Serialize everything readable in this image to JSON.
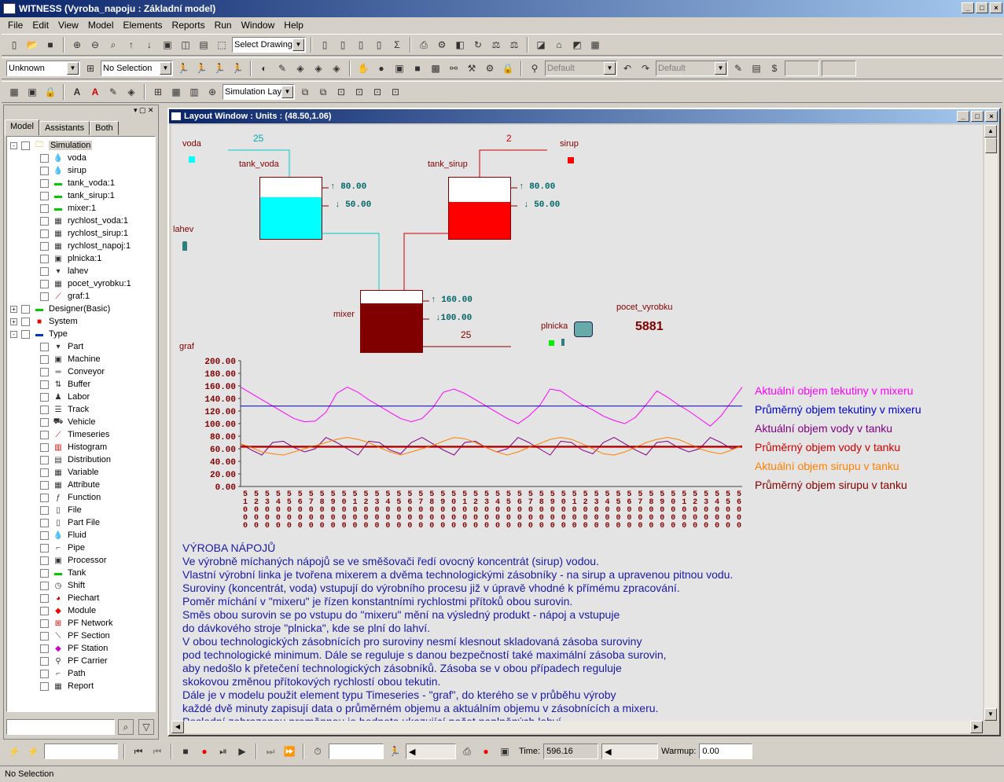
{
  "app": {
    "title": "WITNESS (Vyroba_napoju : Základní model)"
  },
  "menu": [
    "File",
    "Edit",
    "View",
    "Model",
    "Elements",
    "Reports",
    "Run",
    "Window",
    "Help"
  ],
  "toolbar": {
    "select_drawing": "Select Drawing",
    "unknown": "Unknown",
    "no_selection": "No Selection",
    "default1": "Default",
    "default2": "Default",
    "simulation_layer": "Simulation Laye"
  },
  "left_panel": {
    "tabs": [
      "Model",
      "Assistants",
      "Both"
    ],
    "tree": [
      {
        "label": "Simulation",
        "level": 0,
        "exp": "-",
        "icon": "folder-icon"
      },
      {
        "label": "voda",
        "level": 1,
        "icon": "fluid-icon"
      },
      {
        "label": "sirup",
        "level": 1,
        "icon": "fluid-icon"
      },
      {
        "label": "tank_voda:1",
        "level": 1,
        "icon": "tank-icon"
      },
      {
        "label": "tank_sirup:1",
        "level": 1,
        "icon": "tank-icon"
      },
      {
        "label": "mixer:1",
        "level": 1,
        "icon": "tank-icon"
      },
      {
        "label": "rychlost_voda:1",
        "level": 1,
        "icon": "variable-icon"
      },
      {
        "label": "rychlost_sirup:1",
        "level": 1,
        "icon": "variable-icon"
      },
      {
        "label": "rychlost_napoj:1",
        "level": 1,
        "icon": "variable-icon"
      },
      {
        "label": "plnicka:1",
        "level": 1,
        "icon": "processor-icon"
      },
      {
        "label": "lahev",
        "level": 1,
        "icon": "part-icon"
      },
      {
        "label": "pocet_vyrobku:1",
        "level": 1,
        "icon": "variable-icon"
      },
      {
        "label": "graf:1",
        "level": 1,
        "icon": "timeseries-icon"
      },
      {
        "label": "Designer(Basic)",
        "level": 0,
        "exp": "+",
        "icon": "designer-icon"
      },
      {
        "label": "System",
        "level": 0,
        "exp": "+",
        "icon": "system-icon"
      },
      {
        "label": "Type",
        "level": 0,
        "exp": "-",
        "icon": "type-icon"
      },
      {
        "label": "Part",
        "level": 1,
        "icon": "part-icon"
      },
      {
        "label": "Machine",
        "level": 1,
        "icon": "machine-icon"
      },
      {
        "label": "Conveyor",
        "level": 1,
        "icon": "conveyor-icon"
      },
      {
        "label": "Buffer",
        "level": 1,
        "icon": "buffer-icon"
      },
      {
        "label": "Labor",
        "level": 1,
        "icon": "labor-icon"
      },
      {
        "label": "Track",
        "level": 1,
        "icon": "track-icon"
      },
      {
        "label": "Vehicle",
        "level": 1,
        "icon": "vehicle-icon"
      },
      {
        "label": "Timeseries",
        "level": 1,
        "icon": "timeseries-icon"
      },
      {
        "label": "Histogram",
        "level": 1,
        "icon": "histogram-icon"
      },
      {
        "label": "Distribution",
        "level": 1,
        "icon": "distribution-icon"
      },
      {
        "label": "Variable",
        "level": 1,
        "icon": "variable-icon"
      },
      {
        "label": "Attribute",
        "level": 1,
        "icon": "attribute-icon"
      },
      {
        "label": "Function",
        "level": 1,
        "icon": "function-icon"
      },
      {
        "label": "File",
        "level": 1,
        "icon": "file-icon"
      },
      {
        "label": "Part File",
        "level": 1,
        "icon": "partfile-icon"
      },
      {
        "label": "Fluid",
        "level": 1,
        "icon": "fluid-icon"
      },
      {
        "label": "Pipe",
        "level": 1,
        "icon": "pipe-icon"
      },
      {
        "label": "Processor",
        "level": 1,
        "icon": "processor-icon"
      },
      {
        "label": "Tank",
        "level": 1,
        "icon": "tank-icon"
      },
      {
        "label": "Shift",
        "level": 1,
        "icon": "shift-icon"
      },
      {
        "label": "Piechart",
        "level": 1,
        "icon": "piechart-icon"
      },
      {
        "label": "Module",
        "level": 1,
        "icon": "module-icon"
      },
      {
        "label": "PF Network",
        "level": 1,
        "icon": "pfnetwork-icon"
      },
      {
        "label": "PF Section",
        "level": 1,
        "icon": "pfsection-icon"
      },
      {
        "label": "PF Station",
        "level": 1,
        "icon": "pfstation-icon"
      },
      {
        "label": "PF Carrier",
        "level": 1,
        "icon": "pfcarrier-icon"
      },
      {
        "label": "Path",
        "level": 1,
        "icon": "path-icon"
      },
      {
        "label": "Report",
        "level": 1,
        "icon": "report-icon"
      }
    ]
  },
  "layout_window": {
    "title": "Layout Window  : Units : (48.50,1.06)",
    "voda": "voda",
    "sirup": "sirup",
    "lahev": "lahev",
    "tank_voda": "tank_voda",
    "tank_sirup": "tank_sirup",
    "mixer": "mixer",
    "plnicka": "plnicka",
    "pocet_vyrobku": "pocet_vyrobku",
    "pocet_value": "5881",
    "voda_rate": "25",
    "sirup_rate": "2",
    "mixer_rate": "25",
    "tank_voda_hi": "80.00",
    "tank_voda_lo": "50.00",
    "tank_sirup_hi": "80.00",
    "tank_sirup_lo": "50.00",
    "mixer_hi": "160.00",
    "mixer_lo": "100.00",
    "graf": "graf",
    "tank_voda_level": 0.68,
    "tank_sirup_level": 0.6,
    "mixer_level": 0.8
  },
  "chart_data": {
    "type": "line",
    "ylim": [
      0,
      200
    ],
    "yticks": [
      "200.00",
      "180.00",
      "160.00",
      "140.00",
      "120.00",
      "100.00",
      "80.00",
      "60.00",
      "40.00",
      "20.00",
      "0.00"
    ],
    "xticks": [
      "510",
      "520",
      "530",
      "540",
      "550",
      "560",
      "570",
      "580",
      "590",
      "600",
      "610",
      "620",
      "630",
      "640",
      "650",
      "660",
      "670",
      "680",
      "690",
      "700",
      "710",
      "720",
      "730",
      "740",
      "750",
      "760",
      "770",
      "780",
      "790",
      "800",
      "810",
      "820",
      "830",
      "840",
      "850",
      "860",
      "870",
      "880",
      "890",
      "900",
      "910",
      "920",
      "930",
      "940",
      "950",
      "960"
    ],
    "xticks_top": [
      "5",
      "5",
      "5",
      "5",
      "5",
      "5",
      "5",
      "5",
      "5",
      "5",
      "5",
      "5",
      "5",
      "5",
      "5",
      "5",
      "5",
      "5",
      "5",
      "5",
      "5",
      "5",
      "5",
      "5",
      "5",
      "5",
      "5",
      "5",
      "5",
      "5",
      "5",
      "5",
      "5",
      "5",
      "5",
      "5",
      "5",
      "5",
      "5",
      "5",
      "5",
      "5",
      "5",
      "5",
      "5",
      "5"
    ],
    "xticks_mid": [
      "1",
      "2",
      "3",
      "4",
      "5",
      "6",
      "7",
      "8",
      "9",
      "0",
      "1",
      "2",
      "3",
      "4",
      "5",
      "6",
      "7",
      "8",
      "9",
      "0",
      "1",
      "2",
      "3",
      "4",
      "5",
      "6",
      "7",
      "8",
      "9",
      "0",
      "1",
      "2",
      "3",
      "4",
      "5",
      "6",
      "7",
      "8",
      "9",
      "0",
      "1",
      "2",
      "3",
      "4",
      "5",
      "6"
    ],
    "xticks_zero": [
      "0",
      "0",
      "0",
      "0",
      "0",
      "0",
      "0",
      "0",
      "0",
      "0",
      "0",
      "0",
      "0",
      "0",
      "0",
      "0",
      "0",
      "0",
      "0",
      "0",
      "0",
      "0",
      "0",
      "0",
      "0",
      "0",
      "0",
      "0",
      "0",
      "0",
      "0",
      "0",
      "0",
      "0",
      "0",
      "0",
      "0",
      "0",
      "0",
      "0",
      "0",
      "0",
      "0",
      "0",
      "0",
      "0"
    ],
    "series": [
      {
        "name": "Aktuální objem tekutiny v mixeru",
        "color": "#ff00ff",
        "values": [
          158,
          148,
          138,
          128,
          118,
          108,
          103,
          104,
          118,
          148,
          158,
          150,
          138,
          128,
          118,
          108,
          103,
          108,
          125,
          150,
          155,
          148,
          138,
          128,
          118,
          108,
          100,
          112,
          128,
          155,
          152,
          140,
          130,
          122,
          112,
          105,
          100,
          110,
          130,
          152,
          142,
          130,
          120,
          108,
          96,
          112,
          135,
          158
        ]
      },
      {
        "name": "Průměrný objem tekutiny v mixeru",
        "color": "#0000cc",
        "values": [
          128,
          128,
          128,
          128,
          128,
          128,
          128,
          128,
          128,
          128,
          128,
          128,
          128,
          128,
          128,
          128,
          128,
          128,
          128,
          128,
          128,
          128,
          128,
          128,
          128,
          128,
          128,
          128,
          128,
          128,
          128,
          128,
          128,
          128,
          128,
          128,
          128,
          128,
          128,
          128,
          128,
          128,
          128,
          128,
          128,
          128,
          128,
          128
        ]
      },
      {
        "name": "Aktuální objem vody v tanku",
        "color": "#800080",
        "values": [
          68,
          58,
          50,
          70,
          72,
          62,
          55,
          60,
          78,
          70,
          60,
          50,
          72,
          70,
          58,
          52,
          70,
          78,
          68,
          58,
          50,
          70,
          72,
          62,
          55,
          60,
          78,
          70,
          60,
          50,
          72,
          70,
          58,
          52,
          70,
          78,
          68,
          58,
          50,
          70,
          72,
          62,
          55,
          60,
          78,
          70,
          60,
          65
        ]
      },
      {
        "name": "Průměrný objem vody v tanku",
        "color": "#cc0000",
        "values": [
          63,
          63,
          63,
          63,
          63,
          63,
          63,
          63,
          63,
          63,
          63,
          63,
          63,
          63,
          63,
          63,
          63,
          63,
          63,
          63,
          63,
          63,
          63,
          63,
          63,
          63,
          63,
          63,
          63,
          63,
          63,
          63,
          63,
          63,
          63,
          63,
          63,
          63,
          63,
          63,
          63,
          63,
          63,
          63,
          63,
          63,
          63,
          63
        ]
      },
      {
        "name": "Aktuální objem sirupu v tanku",
        "color": "#ff8000",
        "values": [
          68,
          62,
          55,
          52,
          50,
          55,
          60,
          65,
          70,
          75,
          78,
          75,
          70,
          62,
          55,
          50,
          55,
          60,
          65,
          72,
          78,
          76,
          70,
          62,
          55,
          50,
          55,
          62,
          68,
          75,
          78,
          75,
          68,
          60,
          52,
          50,
          55,
          62,
          70,
          75,
          78,
          75,
          68,
          60,
          55,
          52,
          58,
          65
        ]
      },
      {
        "name": "Průměrný objem sirupu v tanku",
        "color": "#800000",
        "values": [
          64,
          64,
          64,
          64,
          64,
          64,
          64,
          64,
          64,
          64,
          64,
          64,
          64,
          64,
          64,
          64,
          64,
          64,
          64,
          64,
          64,
          64,
          64,
          64,
          64,
          64,
          64,
          64,
          64,
          64,
          64,
          64,
          64,
          64,
          64,
          64,
          64,
          64,
          64,
          64,
          64,
          64,
          64,
          64,
          64,
          64,
          64,
          64
        ]
      }
    ]
  },
  "description": {
    "lines": [
      "VÝROBA NÁPOJŮ",
      "Ve výrobně míchaných nápojů se ve směšovači ředí ovocný koncentrát (sirup) vodou.",
      "Vlastní výrobní linka je tvořena mixerem a dvěma technologickými zásobníky - na sirup a upravenou pitnou vodu.",
      "Suroviny (koncentrát, voda) vstupují do výrobního procesu již v úpravě vhodné k přímému zpracování.",
      "Poměr míchání v  \"mixeru\" je řízen konstantními rychlostmi přítoků obou surovin.",
      "Směs obou surovin se po vstupu do \"mixeru\" mění na výsledný produkt - nápoj  a vstupuje",
      "do dávkového stroje \"plnicka\", kde se plní do lahví.",
      "V obou technologických zásobnících pro suroviny nesmí klesnout skladovaná zásoba suroviny",
      "pod technologické minimum. Dále se reguluje s danou bezpečností také maximální zásoba surovin,",
      "aby nedošlo k přetečení technologických zásobníků. Zásoba se v obou případech reguluje",
      "skokovou změnou přítokových rychlostí obou tekutin.",
      "Dále je v modelu použit element typu Timeseries - \"graf\", do kterého se v průběhu výroby",
      "každé dvě minuty zapisují data o průměrném objemu a aktuálním objemu v zásobnících a mixeru.",
      "Poslední zobrazenou proměnnou je hodnota ukazující počet naplněných lahví."
    ]
  },
  "bottom": {
    "time_label": "Time:",
    "time_value": "596.16",
    "warmup_label": "Warmup:",
    "warmup_value": "0.00"
  },
  "status": "No Selection"
}
